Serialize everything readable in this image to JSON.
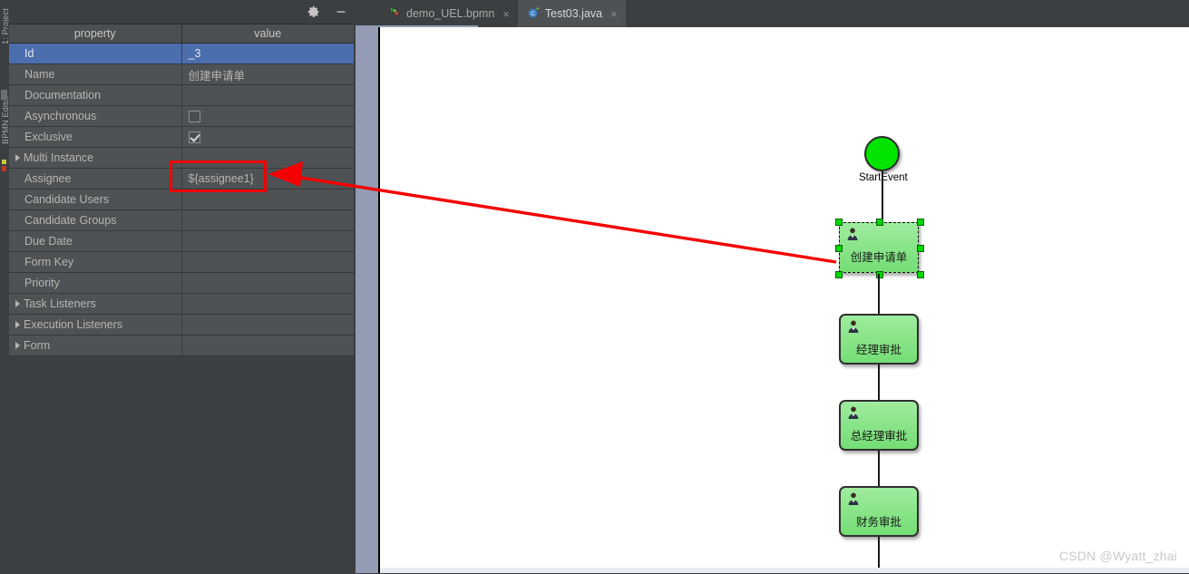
{
  "toolwindow_labels": {
    "project": "1: Project",
    "bpmn_editor": "BPMN Editor"
  },
  "properties_panel": {
    "settings_icon": "gear-icon",
    "minimize_icon": "minimize-icon",
    "columns": [
      "property",
      "value"
    ],
    "rows": [
      {
        "property": "Id",
        "value": "_3",
        "type": "text",
        "expandable": false,
        "selected": true
      },
      {
        "property": "Name",
        "value": "创建申请单",
        "type": "text",
        "expandable": false,
        "selected": false
      },
      {
        "property": "Documentation",
        "value": "",
        "type": "text",
        "expandable": false,
        "selected": false
      },
      {
        "property": "Asynchronous",
        "value": "",
        "type": "checkbox",
        "checked": false,
        "expandable": false,
        "selected": false
      },
      {
        "property": "Exclusive",
        "value": "",
        "type": "checkbox",
        "checked": true,
        "expandable": false,
        "selected": false
      },
      {
        "property": "Multi Instance",
        "value": "",
        "type": "text",
        "expandable": true,
        "selected": false
      },
      {
        "property": "Assignee",
        "value": "${assignee1}",
        "type": "text",
        "expandable": false,
        "selected": false,
        "highlighted": true
      },
      {
        "property": "Candidate Users",
        "value": "",
        "type": "text",
        "expandable": false,
        "selected": false
      },
      {
        "property": "Candidate Groups",
        "value": "",
        "type": "text",
        "expandable": false,
        "selected": false
      },
      {
        "property": "Due Date",
        "value": "",
        "type": "text",
        "expandable": false,
        "selected": false
      },
      {
        "property": "Form Key",
        "value": "",
        "type": "text",
        "expandable": false,
        "selected": false
      },
      {
        "property": "Priority",
        "value": "",
        "type": "text",
        "expandable": false,
        "selected": false
      },
      {
        "property": "Task Listeners",
        "value": "",
        "type": "text",
        "expandable": true,
        "selected": false
      },
      {
        "property": "Execution Listeners",
        "value": "",
        "type": "text",
        "expandable": true,
        "selected": false
      },
      {
        "property": "Form",
        "value": "",
        "type": "text",
        "expandable": true,
        "selected": false
      }
    ]
  },
  "editor_tabs": [
    {
      "label": "demo_UEL.bpmn",
      "icon": "bpmn-file-icon",
      "active": false,
      "close": "×"
    },
    {
      "label": "Test03.java",
      "icon": "java-class-icon",
      "active": true,
      "close": "×"
    }
  ],
  "diagram": {
    "start_event": {
      "label": "StartEvent",
      "color": "#00e400"
    },
    "tasks": [
      {
        "label": "创建申请单",
        "selected": true,
        "color": "#7fe37f"
      },
      {
        "label": "经理审批",
        "selected": false,
        "color": "#7fe37f"
      },
      {
        "label": "总经理审批",
        "selected": false,
        "color": "#7fe37f"
      },
      {
        "label": "财务审批",
        "selected": false,
        "color": "#7fe37f"
      }
    ]
  },
  "annotation": {
    "color": "#f40000",
    "highlight_target": "assignee-value-cell",
    "arrow_points_to": "${assignee1}"
  },
  "watermark": "CSDN @Wyatt_zhai",
  "colors": {
    "selection_blue": "#4b6eaf",
    "panel_bg": "#3c3f41",
    "row_bg": "#4e5254",
    "header_bg": "#4b4f51",
    "canvas_bg": "#ffffff",
    "annotation_red": "#f40000",
    "scroll_strip": "#939cb4"
  }
}
